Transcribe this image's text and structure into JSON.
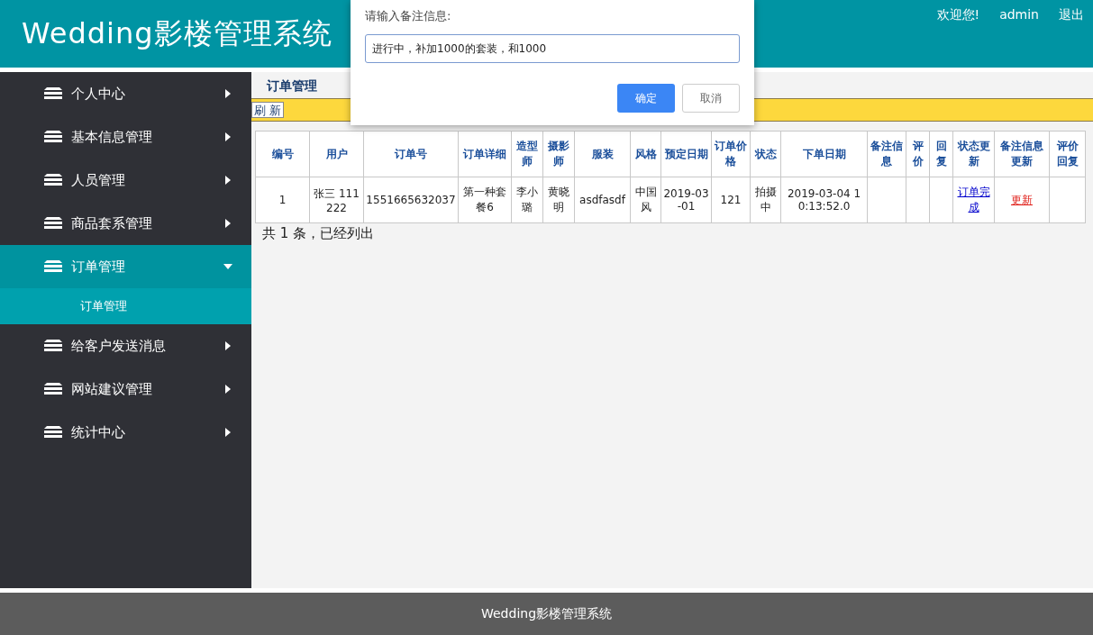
{
  "header": {
    "title": "Wedding影楼管理系统",
    "welcome": "欢迎您!",
    "user": "admin",
    "logout": "退出"
  },
  "sidebar": {
    "items": [
      {
        "label": "个人中心",
        "expanded": false,
        "selected": false
      },
      {
        "label": "基本信息管理",
        "expanded": false,
        "selected": false
      },
      {
        "label": "人员管理",
        "expanded": false,
        "selected": false
      },
      {
        "label": "商品套系管理",
        "expanded": false,
        "selected": false
      },
      {
        "label": "订单管理",
        "expanded": true,
        "selected": true,
        "children": [
          {
            "label": "订单管理",
            "selected": true
          }
        ]
      },
      {
        "label": "给客户发送消息",
        "expanded": false,
        "selected": false
      },
      {
        "label": "网站建议管理",
        "expanded": false,
        "selected": false
      },
      {
        "label": "统计中心",
        "expanded": false,
        "selected": false
      }
    ]
  },
  "content": {
    "title": "订单管理",
    "refresh_button": "刷 新",
    "table": {
      "columns": [
        "编号",
        "用户",
        "订单号",
        "订单详细",
        "造型师",
        "摄影师",
        "服装",
        "风格",
        "预定日期",
        "订单价格",
        "状态",
        "下单日期",
        "备注信息",
        "评价",
        "回复",
        "状态更新",
        "备注信息更新",
        "评价回复"
      ],
      "rows": [
        [
          {
            "text": "1",
            "kind": "text"
          },
          {
            "text": "张三 111222",
            "kind": "text"
          },
          {
            "text": "1551665632037",
            "kind": "text"
          },
          {
            "text": "第一种套餐6",
            "kind": "text"
          },
          {
            "text": "李小璐",
            "kind": "text"
          },
          {
            "text": "黄晓明",
            "kind": "text"
          },
          {
            "text": "asdfasdf",
            "kind": "text"
          },
          {
            "text": "中国风",
            "kind": "text"
          },
          {
            "text": "2019-03-01",
            "kind": "text"
          },
          {
            "text": "121",
            "kind": "text"
          },
          {
            "text": "拍摄中",
            "kind": "text"
          },
          {
            "text": "2019-03-04 10:13:52.0",
            "kind": "text"
          },
          {
            "kind": "empty"
          },
          {
            "kind": "empty"
          },
          {
            "kind": "empty"
          },
          {
            "text": "订单完成",
            "kind": "link"
          },
          {
            "text": "更新",
            "kind": "alert-link"
          },
          {
            "kind": "empty"
          }
        ]
      ]
    },
    "summary": "共 1 条，已经列出"
  },
  "dialog": {
    "prompt": "请输入备注信息:",
    "value": "进行中，补加1000的套装，和1000",
    "confirm": "确定",
    "cancel": "取消"
  },
  "footer": "Wedding影楼管理系统"
}
